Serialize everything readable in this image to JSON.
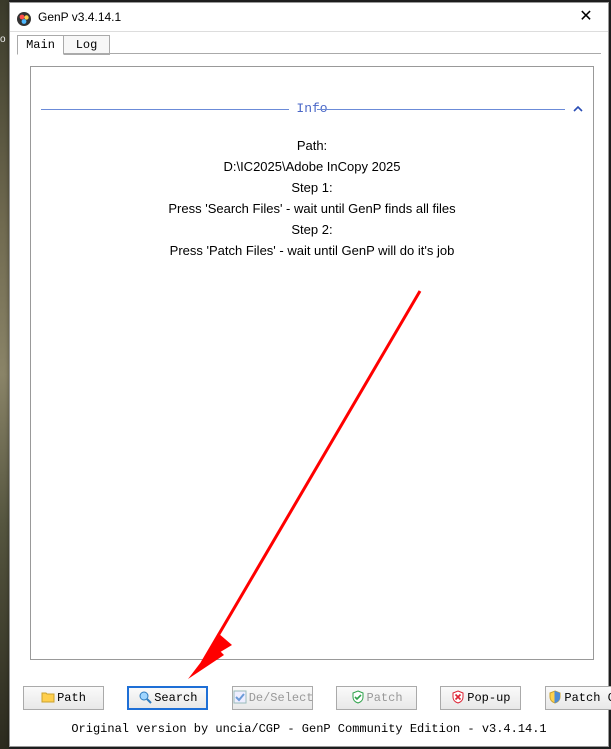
{
  "window": {
    "title": "GenP v3.4.14.1",
    "close": "✕"
  },
  "edge_char": "o",
  "tabs": {
    "main": "Main",
    "log": "Log"
  },
  "info": {
    "header": "Info",
    "path_label": "Path:",
    "path_value": "D:\\IC2025\\Adobe InCopy 2025",
    "step1_label": "Step 1:",
    "step1_text": "Press 'Search Files' - wait until GenP finds all files",
    "step2_label": "Step 2:",
    "step2_text": "Press 'Patch Files' - wait until GenP will do it's job"
  },
  "buttons": {
    "path": "Path",
    "search": "Search",
    "deselect": "De/Select",
    "patch": "Patch",
    "popup": "Pop-up",
    "patchcc": "Patch CC"
  },
  "footer": "Original version by uncia/CGP - GenP Community Edition - v3.4.14.1"
}
